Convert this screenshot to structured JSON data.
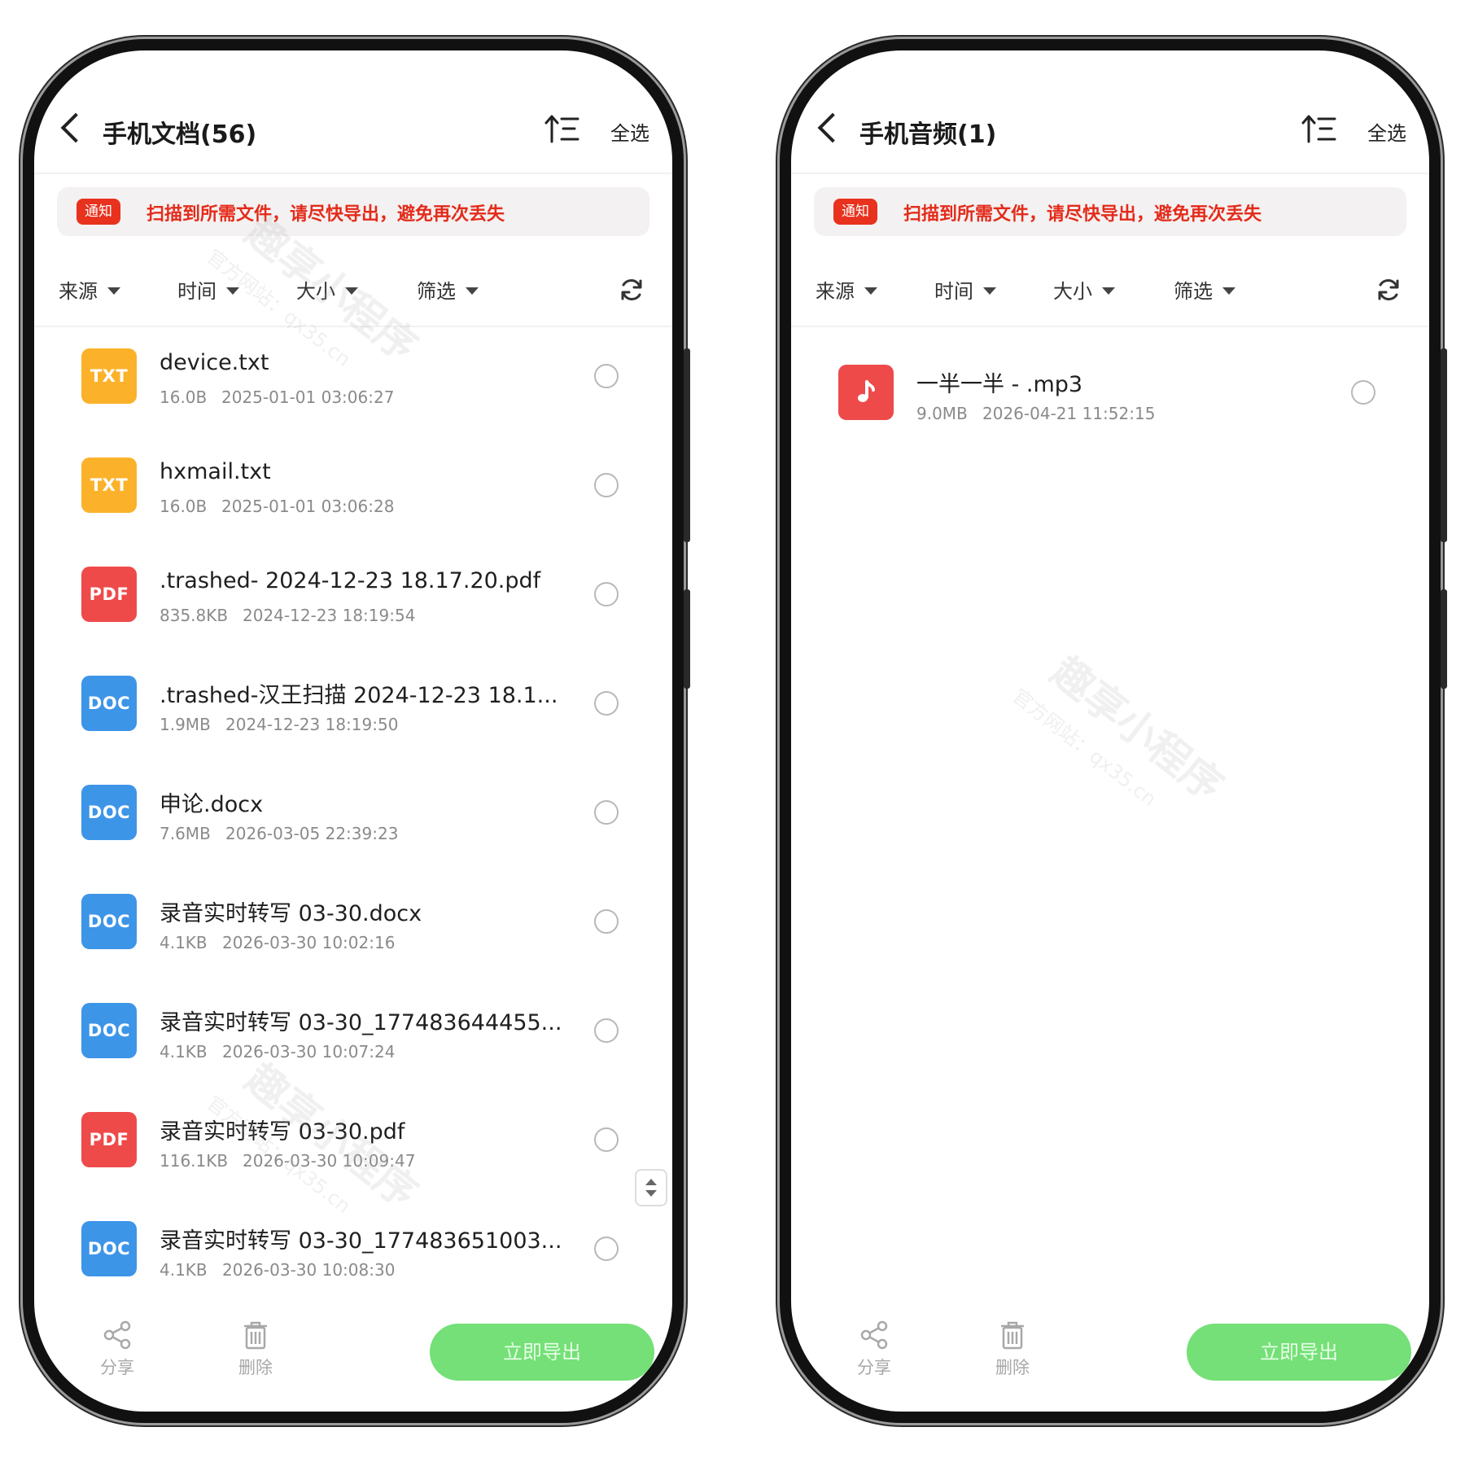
{
  "notice": {
    "badge": "通知",
    "text": "扫描到所需文件，请尽快导出，避免再次丢失"
  },
  "header": {
    "select_all": "全选",
    "sort_icon": "sort-ascending-icon",
    "back_icon": "chevron-left-icon"
  },
  "filters": [
    "来源",
    "时间",
    "大小",
    "筛选"
  ],
  "watermark": {
    "title": "趣享小程序",
    "subtitle": "官方网站：qx35.cn"
  },
  "toolbar": {
    "share_label": "分享",
    "delete_label": "删除",
    "export_label": "立即导出"
  },
  "colors": {
    "txt": "#fbb22a",
    "pdf": "#ee4a4a",
    "doc": "#3d95e8",
    "audio": "#ee4a4a",
    "notice_red": "#e42b1a",
    "export_green": "#74e077"
  },
  "left_screen": {
    "title": "手机文档(56)",
    "files": [
      {
        "type": "TXT",
        "name": "device.txt",
        "size": "16.0B",
        "date": "2025-01-01 03:06:27"
      },
      {
        "type": "TXT",
        "name": "hxmail.txt",
        "size": "16.0B",
        "date": "2025-01-01 03:06:28"
      },
      {
        "type": "PDF",
        "name": ".trashed- 2024-12-23 18.17.20.pdf",
        "size": "835.8KB",
        "date": "2024-12-23 18:19:54"
      },
      {
        "type": "DOC",
        "name": ".trashed-汉王扫描 2024-12-23 18.1...",
        "size": "1.9MB",
        "date": "2024-12-23 18:19:50"
      },
      {
        "type": "DOC",
        "name": "申论.docx",
        "size": "7.6MB",
        "date": "2026-03-05 22:39:23"
      },
      {
        "type": "DOC",
        "name": "录音实时转写 03-30.docx",
        "size": "4.1KB",
        "date": "2026-03-30 10:02:16"
      },
      {
        "type": "DOC",
        "name": "录音实时转写 03-30_177483644455...",
        "size": "4.1KB",
        "date": "2026-03-30 10:07:24"
      },
      {
        "type": "PDF",
        "name": "录音实时转写 03-30.pdf",
        "size": "116.1KB",
        "date": "2026-03-30 10:09:47"
      },
      {
        "type": "DOC",
        "name": "录音实时转写 03-30_177483651003...",
        "size": "4.1KB",
        "date": "2026-03-30 10:08:30"
      }
    ]
  },
  "right_screen": {
    "title": "手机音频(1)",
    "files": [
      {
        "type": "AUDIO",
        "icon": "music-note-icon",
        "name": "一半一半 - .mp3",
        "size": "9.0MB",
        "date": "2026-04-21 11:52:15"
      }
    ]
  }
}
